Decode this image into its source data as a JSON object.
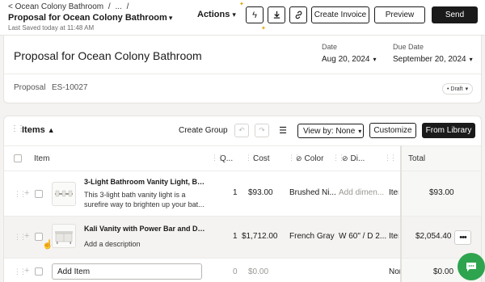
{
  "topbar": {
    "breadcrumbs": [
      "< Ocean Colony Bathroom",
      "/",
      "...",
      "/"
    ],
    "title": "Proposal for Ocean Colony Bathroom",
    "saved": "Last Saved today at 11:48 AM",
    "actions_label": "Actions",
    "create_invoice": "Create Invoice",
    "preview": "Preview",
    "send": "Send"
  },
  "proposal": {
    "title": "Proposal for Ocean Colony Bathroom",
    "date_label": "Date",
    "date_value": "Aug 20, 2024",
    "due_date_label": "Due Date",
    "due_date_value": "September 20, 2024",
    "type_label": "Proposal",
    "number": "ES-10027",
    "status": "• Draft"
  },
  "items": {
    "title": "Items",
    "create_group": "Create Group",
    "view_by": "View by: None",
    "customize": "Customize",
    "from_library": "From Library",
    "columns": {
      "item": "Item",
      "qty": "Q...",
      "cost": "Cost",
      "color": "Color",
      "dim": "Di...",
      "total": "Total"
    },
    "rows": [
      {
        "name": "3-Light Bathroom Vanity Light, Brus...",
        "description": "This 3-light bath vanity light is a surefire way to brighten up your bat...",
        "qty": "1",
        "cost": "$93.00",
        "color": "Brushed Ni...",
        "dimension": "Add dimen...",
        "unit": "Item",
        "total": "$93.00"
      },
      {
        "name": "Kali Vanity with Power Bar and Dra...",
        "description": "Add a description",
        "qty": "1",
        "cost": "$1,712.00",
        "color": "French Gray",
        "dimension": "W 60\" / D 2...",
        "unit": "Item",
        "total": "$2,054.40"
      }
    ],
    "add_row": {
      "placeholder": "Add Item",
      "qty": "0",
      "cost": "$0.00",
      "unit": "Non",
      "total": "$0.00"
    }
  },
  "colors": {
    "accent_dark": "#1a1a1a",
    "chat_green": "#2ea44f",
    "background": "#f4f3f1"
  }
}
